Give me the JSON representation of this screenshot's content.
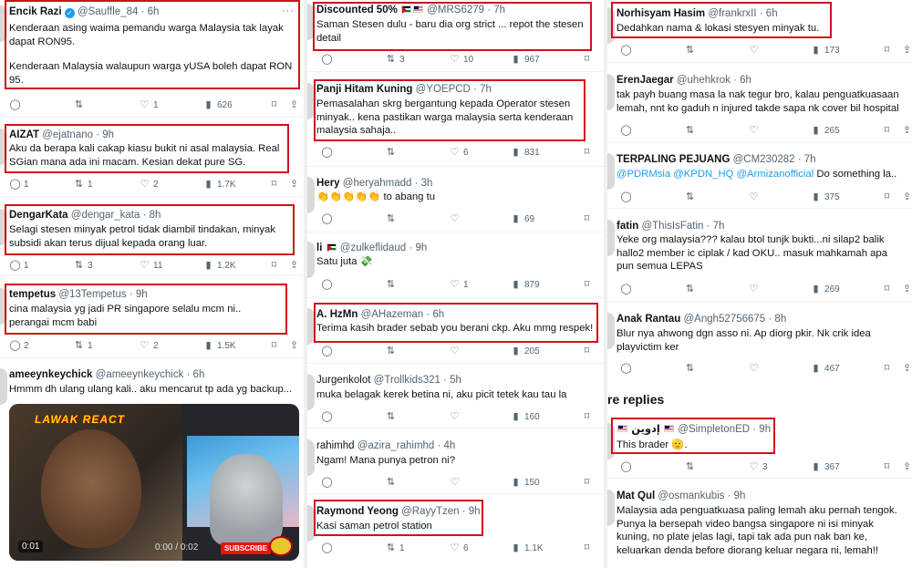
{
  "columns": [
    {
      "tweets": [
        {
          "name": "Encik Razi",
          "verified": true,
          "handle": "@Sauffle_84",
          "time": "· 6h",
          "text1": "Kenderaan asing waima pemandu warga Malaysia tak layak dapat RON95.",
          "text2": "Kenderaan Malaysia walaupun warga yUSA boleh dapat RON 95.",
          "replies": "",
          "retweets": "",
          "likes": "1",
          "views": "626"
        },
        {
          "name": "AIZAT",
          "handle": "@ejatnano",
          "time": "· 9h",
          "text1": "Aku da berapa kali cakap kiasu bukit ni asal malaysia. Real SGian mana ada ini macam. Kesian dekat pure SG.",
          "replies": "1",
          "retweets": "1",
          "likes": "2",
          "views": "1.7K"
        },
        {
          "name": "DengarKata",
          "handle": "@dengar_kata",
          "time": "· 8h",
          "text1": "Selagi stesen minyak petrol tidak diambil tindakan, minyak subsidi akan terus dijual kepada orang luar.",
          "replies": "1",
          "retweets": "3",
          "likes": "11",
          "views": "1.2K"
        },
        {
          "name": "tempetus",
          "handle": "@13Tempetus",
          "time": "· 9h",
          "text1": "cina malaysia yg jadi PR singapore selalu mcm ni.. perangai mcm babi",
          "replies": "2",
          "retweets": "1",
          "likes": "2",
          "views": "1.5K"
        },
        {
          "name": "ameeynkeychick",
          "handle": "@ameeynkeychick",
          "time": "· 6h",
          "text1": "Hmmm dh ulang ulang kali.. aku mencarut tp ada yg backup..."
        }
      ],
      "video": {
        "logo": "LAWAK REACT",
        "elapsed": "0:01",
        "player_time": "0:00 / 0:02",
        "subscribe": "SUBSCRIBE"
      }
    },
    {
      "tweets": [
        {
          "name": "Discounted 50%",
          "handle": "@MRS6279",
          "time": "· 7h",
          "text1": "Saman Stesen dulu - baru dia org strict ... repot the stesen detail",
          "replies": "",
          "retweets": "3",
          "likes": "10",
          "views": "967"
        },
        {
          "name": "Panji Hitam Kuning",
          "handle": "@YOEPCD",
          "time": "· 7h",
          "text1": "Pemasalahan skrg bergantung kepada Operator stesen minyak.. kena pastikan warga malaysia serta kenderaan malaysia sahaja..",
          "replies": "",
          "retweets": "",
          "likes": "6",
          "views": "831"
        },
        {
          "name": "Hery",
          "handle": "@heryahmadd",
          "time": "· 3h",
          "emoji": "👏👏👏👏👏",
          "text1": "to abang tu",
          "replies": "",
          "retweets": "",
          "likes": "",
          "views": "69"
        },
        {
          "name": "li",
          "handle": "@zulkeflidaud",
          "time": "· 9h",
          "text1": "Satu juta 💸",
          "replies": "",
          "retweets": "",
          "likes": "1",
          "views": "879"
        },
        {
          "name": "A. HzMn",
          "handle": "@AHazeman",
          "time": "· 6h",
          "text1": "Terima kasih brader sebab you berani ckp. Aku mmg respek!",
          "replies": "",
          "retweets": "",
          "likes": "",
          "views": "205"
        },
        {
          "name": "Jurgenkolot",
          "handle": "@Trollkids321",
          "time": "· 5h",
          "text1": "muka belagak kerek betina ni, aku picit tetek kau tau la",
          "replies": "",
          "retweets": "",
          "likes": "",
          "views": "160"
        },
        {
          "name": "rahimhd",
          "handle": "@azira_rahimhd",
          "time": "· 4h",
          "text1": "Ngam! Mana punya petron ni?",
          "replies": "",
          "retweets": "",
          "likes": "",
          "views": "150"
        },
        {
          "name": "Raymond Yeong",
          "handle": "@RayyTzen",
          "time": "· 9h",
          "text1": "Kasi saman petrol station",
          "replies": "",
          "retweets": "1",
          "likes": "6",
          "views": "1.1K"
        }
      ]
    },
    {
      "tweets": [
        {
          "name": "Norhisyam Hasim",
          "handle": "@frankrxII",
          "time": "· 6h",
          "text1": "Dedahkan nama & lokasi stesyen minyak tu.",
          "views": "173"
        },
        {
          "name": "ErenJaegar",
          "handle": "@uhehkrok",
          "time": "· 6h",
          "text1": "tak payh buang masa la nak tegur bro, kalau penguatkuasaan lemah, nnt ko gaduh n injured takde sapa nk cover bil hospital",
          "views": "265"
        },
        {
          "name": "TERPALING PEJUANG",
          "handle": "@CM230282",
          "time": "· 7h",
          "link": "@PDRMsia @KPDN_HQ @Armizanofficial",
          "text1": "Do something la..",
          "likes": "",
          "views": "375"
        },
        {
          "name": "fatin",
          "handle": "@ThisIsFatin",
          "time": "· 7h",
          "text1": "Yeke org malaysia??? kalau btol tunjk bukti...ni silap2 balik hallo2 member ic ciplak / kad OKU.. masuk mahkamah apa pun semua LEPAS",
          "views": "269"
        },
        {
          "name": "Anak Rantau",
          "handle": "@Angh52756675",
          "time": "· 8h",
          "text1": "Blur nya ahwong dgn asso ni. Ap diorg pkir. Nk crik idea playvictim ker",
          "views": "467"
        },
        {
          "name": "إدوين",
          "handle": "@SimpletonED",
          "time": "· 9h",
          "text1": "This brader 🫡.",
          "likes": "3",
          "views": "367"
        },
        {
          "name": "Mat Qul",
          "handle": "@osmankubis",
          "time": "· 9h",
          "text1": "Malaysia ada penguatkuasa paling lemah aku pernah tengok. Punya la bersepah video bangsa singapore ni isi minyak kuning, no plate jelas lagi, tapi tak ada pun nak ban ke, keluarkan denda before diorang keluar negara ni, lemah!!"
        }
      ],
      "section_title": "re replies"
    }
  ],
  "icons": {
    "reply": "reply-icon",
    "retweet": "retweet-icon",
    "like": "heart-icon",
    "views": "views-icon",
    "bookmark": "bookmark-icon",
    "share": "share-icon",
    "more": "more-icon"
  },
  "colors": {
    "highlight": "#d0111b",
    "link": "#1d9bf0",
    "muted": "#536471"
  }
}
